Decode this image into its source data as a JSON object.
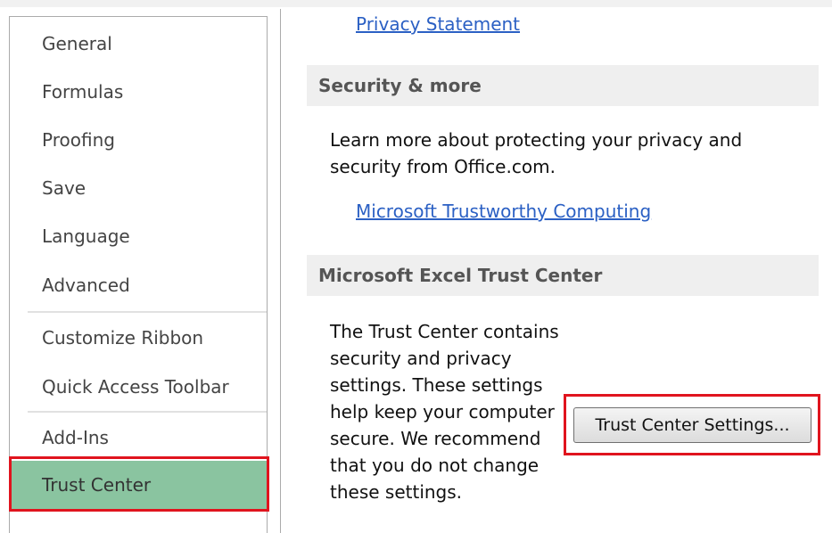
{
  "nav": {
    "items": [
      {
        "id": "general",
        "label": "General"
      },
      {
        "id": "formulas",
        "label": "Formulas"
      },
      {
        "id": "proofing",
        "label": "Proofing"
      },
      {
        "id": "save",
        "label": "Save"
      },
      {
        "id": "language",
        "label": "Language"
      },
      {
        "id": "advanced",
        "label": "Advanced"
      },
      {
        "id": "customize-ribbon",
        "label": "Customize Ribbon"
      },
      {
        "id": "quick-access-toolbar",
        "label": "Quick Access Toolbar"
      },
      {
        "id": "add-ins",
        "label": "Add-Ins"
      },
      {
        "id": "trust-center",
        "label": "Trust Center"
      }
    ],
    "selected": "Trust Center"
  },
  "content": {
    "privacy_link": "Privacy Statement",
    "security": {
      "header": "Security & more",
      "text": "Learn more about protecting your privacy and security from Office.com.",
      "link": "Microsoft Trustworthy Computing"
    },
    "trust_center": {
      "header": "Microsoft Excel Trust Center",
      "text": "The Trust Center contains security and privacy settings. These settings help keep your computer secure. We recommend that you do not change these settings.",
      "button_label": "Trust Center Settings..."
    }
  },
  "colors": {
    "selected_bg": "#8ac4a0",
    "highlight_outline": "#e0141e",
    "link": "#2b60c4"
  }
}
